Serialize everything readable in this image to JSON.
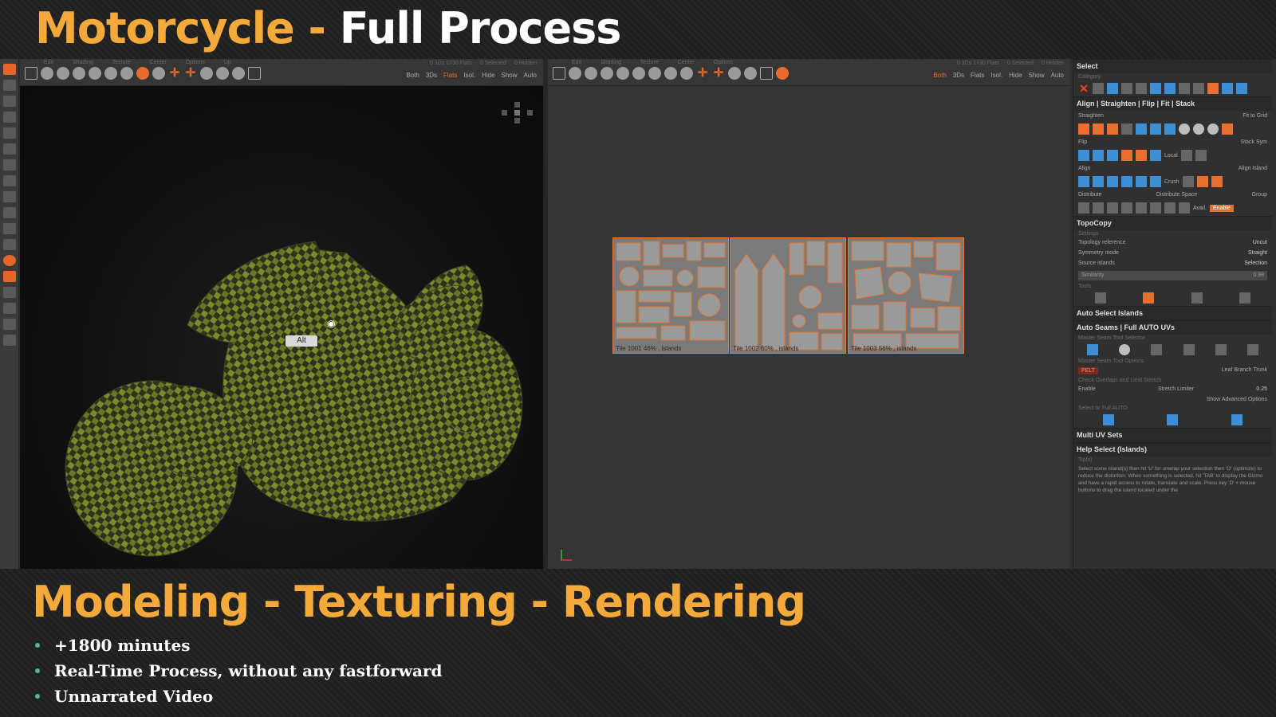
{
  "banner": {
    "title_part1": "Motorcycle",
    "title_sep": " - ",
    "title_part2": "Full Process",
    "subtitle": "Modeling - Texturing - Rendering",
    "bullets": [
      "+1800 minutes",
      "Real-Time Process, without any fastforward",
      "Unnarrated Video"
    ]
  },
  "viewport3d": {
    "toolbar_labels": [
      "Edit",
      "Shading",
      "Texture",
      "Center",
      "Options",
      "Up"
    ],
    "stats": [
      "0 3Ds 1730 Flats",
      "0 Selected",
      "0 Hidden"
    ],
    "buttons": [
      "Both",
      "3Ds",
      "Flats",
      "Isol.",
      "Hide",
      "Show",
      "Auto"
    ],
    "active_button": "Flats",
    "alt_key_hint": "Alt",
    "alt_cursor_hint": "Alt"
  },
  "viewportUV": {
    "toolbar_labels": [
      "Edit",
      "Shading",
      "Texture",
      "Center",
      "Options"
    ],
    "stats": [
      "0 3Ds 1730 Flats",
      "0 Selected",
      "0 Hidden"
    ],
    "buttons": [
      "Both",
      "3Ds",
      "Flats",
      "Isol.",
      "Hide",
      "Show",
      "Auto"
    ],
    "active_button": "Both",
    "tiles": [
      "Tile 1001 46% , islands",
      "Tile 1002 60% , islands",
      "Tile 1003 56% , islands"
    ]
  },
  "rightPanel": {
    "select": {
      "title": "Select",
      "sub": "Category"
    },
    "align": {
      "title": "Align | Straighten | Flip | Fit | Stack",
      "straighten": "Straighten",
      "fit_to_grid": "Fit to Grid",
      "flip": "Flip",
      "stack_sym": "Stack Sym",
      "local": "Local",
      "align": "Align",
      "align_island": "Align Island",
      "crush": "Crush",
      "distribute": "Distribute",
      "distribute_space": "Distribute Space",
      "group": "Group",
      "avail": "Avail.",
      "enable": "Enable"
    },
    "topocopy": {
      "title": "TopoCopy",
      "settings": "Settings",
      "props": [
        {
          "label": "Topology reference",
          "value": "Uncut"
        },
        {
          "label": "Symmetry mode",
          "value": "Straight"
        },
        {
          "label": "Source islands",
          "value": "Selection"
        }
      ],
      "similarity_label": "Similarity",
      "similarity_value": "0.98",
      "tools": "Tools"
    },
    "auto_select": {
      "title": "Auto Select Islands"
    },
    "auto_seams": {
      "title": "Auto Seams | Full AUTO UVs",
      "selector_label": "Master Seam Tool Selector",
      "options_label": "Master Seam Tool Options",
      "pelt": "PELT",
      "leaf": "Leaf",
      "branch": "Branch",
      "trunk": "Trunk",
      "overlap_label": "Check Overlaps and Limit Stretch",
      "enable": "Enable",
      "stretch_label": "Stretch Limiter",
      "stretch_value": "0.25",
      "advanced": "Show Advanced Options",
      "full_auto": "Select or Full AUTO"
    },
    "multi_uv": {
      "title": "Multi UV Sets"
    },
    "help": {
      "title": "Help Select (Islands)",
      "tip_label": "Tip(s)",
      "text": "Select some island(s) then hit 'U' for unwrap your selection then 'O' (optimize) to reduce the distortion. When something is selected, hit 'TAB' to display the Gizmo and have a rapid access to rotate, translate and scale. Press key 'D' + mouse buttons to drag the island located under the"
    }
  }
}
